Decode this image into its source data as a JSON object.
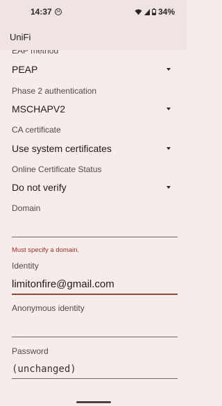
{
  "status_bar": {
    "time": "14:37",
    "notification_glyph": "34",
    "battery": "34%"
  },
  "app_bar": {
    "title": "UniFi"
  },
  "form": {
    "eap_method": {
      "label": "EAP method",
      "value": "PEAP"
    },
    "phase2": {
      "label": "Phase 2 authentication",
      "value": "MSCHAPV2"
    },
    "ca_cert": {
      "label": "CA certificate",
      "value": "Use system certificates"
    },
    "ocsp": {
      "label": "Online Certificate Status",
      "value": "Do not verify"
    },
    "domain": {
      "label": "Domain",
      "value": "",
      "error": "Must specify a domain."
    },
    "identity": {
      "label": "Identity",
      "value": "limitonfire@gmail.com"
    },
    "anonymous_identity": {
      "label": "Anonymous identity",
      "value": ""
    },
    "password": {
      "label": "Password",
      "value": "(unchanged)"
    }
  }
}
